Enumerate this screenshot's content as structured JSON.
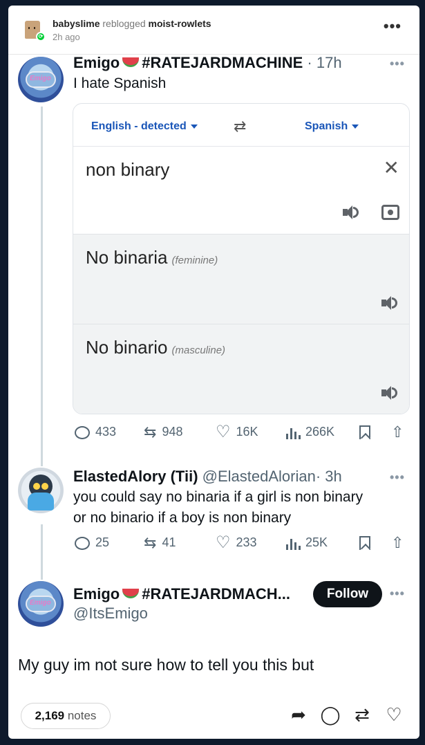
{
  "post_header": {
    "reblogger": "babyslime",
    "action": "reblogged",
    "original": "moist-rowlets",
    "time": "2h ago",
    "more": "•••"
  },
  "tweet1": {
    "avatar_label": "Emigo",
    "name": "Emigo",
    "hashtag": "#RATEJARDMACHINE",
    "time": "· 17h",
    "text": "I hate Spanish",
    "more": "•••",
    "translate": {
      "source_lang": "English - detected",
      "target_lang": "Spanish",
      "input": "non binary",
      "outputs": [
        {
          "text": "No binaria",
          "gender": "(feminine)"
        },
        {
          "text": "No binario",
          "gender": "(masculine)"
        }
      ]
    },
    "stats": {
      "replies": "433",
      "reposts": "948",
      "likes": "16K",
      "views": "266K"
    }
  },
  "tweet2": {
    "name": "ElastedAlory (Tii)",
    "handle": "@ElastedAlorian",
    "time": "· 3h",
    "more": "•••",
    "text_line1": "you could say no binaria if a girl is non binary",
    "text_line2": "or no binario if a boy is non binary",
    "stats": {
      "replies": "25",
      "reposts": "41",
      "likes": "233",
      "views": "25K"
    }
  },
  "tweet3": {
    "avatar_label": "Emigo",
    "name": "Emigo",
    "hashtag": "#RATEJARDMACH...",
    "handle": "@ItsEmigo",
    "follow": "Follow",
    "more": "•••",
    "text": "My guy im not sure how to tell you this but"
  },
  "footer": {
    "notes_count": "2,169",
    "notes_label": "notes"
  },
  "icons": [
    "reply-icon",
    "repost-icon",
    "heart-icon",
    "views-icon",
    "bookmark-icon",
    "share-icon",
    "speaker-icon",
    "camera-icon",
    "close-icon",
    "swap-icon"
  ]
}
